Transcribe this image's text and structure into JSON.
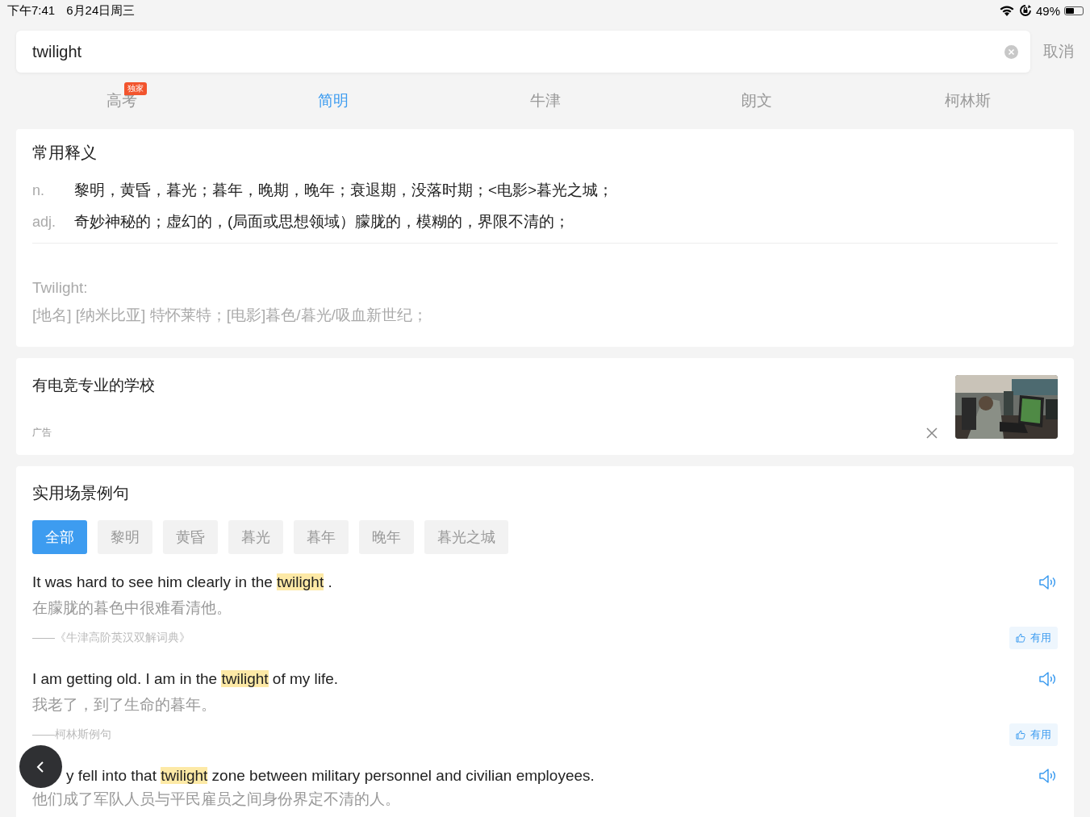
{
  "status_bar": {
    "time": "下午7:41",
    "date": "6月24日周三",
    "battery": "49%"
  },
  "search": {
    "value": "twilight",
    "cancel": "取消"
  },
  "tabs": [
    {
      "label": "高考",
      "badge": "独家",
      "selected": false
    },
    {
      "label": "简明",
      "selected": true
    },
    {
      "label": "牛津",
      "selected": false
    },
    {
      "label": "朗文",
      "selected": false
    },
    {
      "label": "柯林斯",
      "selected": false
    }
  ],
  "definitions": {
    "title": "常用释义",
    "senses": [
      {
        "pos": "n.",
        "text": "黎明，黄昏，暮光；暮年，晚期，晚年；衰退期，没落时期；<电影>暮光之城；"
      },
      {
        "pos": "adj.",
        "text": "奇妙神秘的；虚幻的，(局面或思想领域）朦胧的，模糊的，界限不清的；"
      }
    ],
    "proper": {
      "word": "Twilight:",
      "text": "[地名] [纳米比亚] 特怀莱特；[电影]暮色/暮光/吸血新世纪；"
    }
  },
  "ad": {
    "title": "有电竞专业的学校",
    "label": "广告"
  },
  "examples": {
    "title": "实用场景例句",
    "filters": [
      {
        "label": "全部",
        "selected": true
      },
      {
        "label": "黎明",
        "selected": false
      },
      {
        "label": "黄昏",
        "selected": false
      },
      {
        "label": "暮光",
        "selected": false
      },
      {
        "label": "暮年",
        "selected": false
      },
      {
        "label": "晚年",
        "selected": false
      },
      {
        "label": "暮光之城",
        "selected": false
      }
    ],
    "items": [
      {
        "before": "It was hard to see him clearly in the ",
        "highlight": "twilight",
        "after": " .",
        "translation": "在朦胧的暮色中很难看清他。",
        "source": "——《牛津高阶英汉双解词典》",
        "useful": "有用"
      },
      {
        "before": "I am getting old. I am in the ",
        "highlight": "twilight",
        "after": " of my life.",
        "translation": "我老了，到了生命的暮年。",
        "source": "——柯林斯例句",
        "useful": "有用"
      },
      {
        "before": "y fell into that ",
        "highlight": "twilight",
        "after": " zone between military personnel and civilian employees.",
        "translation": "他们成了军队人员与平民雇员之间身份界定不清的人。"
      }
    ]
  }
}
